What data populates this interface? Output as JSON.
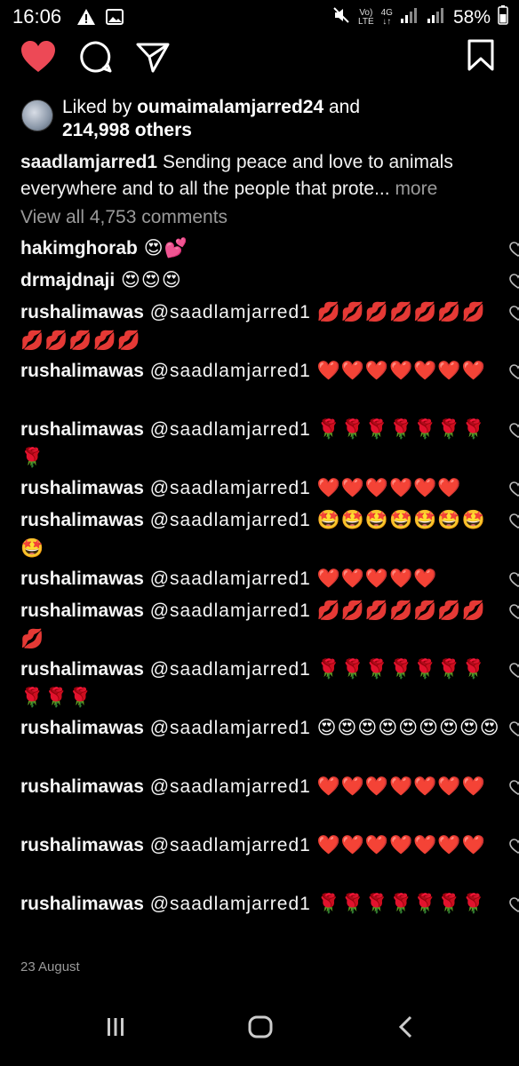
{
  "status_bar": {
    "time": "16:06",
    "net_top": "Vo)",
    "net_bottom": "LTE",
    "net2_top": "4G",
    "net2_bottom": "↓↑",
    "battery": "58%"
  },
  "post": {
    "likes_prefix": "Liked by ",
    "liked_by_user": "oumaimalamjarred24",
    "likes_and": " and",
    "likes_others": "214,998 others",
    "caption_user": "saadlamjarred1",
    "caption_text": " Sending peace and love to animals everywhere and to all the people that prote...",
    "more_label": " more",
    "view_all_comments": "View all 4,753 comments",
    "date": "23 August"
  },
  "comments": [
    {
      "user": "hakimghorab",
      "text": " 😍💕"
    },
    {
      "user": "drmajdnaji",
      "text": " 😍😍😍"
    },
    {
      "user": "rushalimawas",
      "text": " @saadlamjarred1 💋💋💋💋💋💋💋💋💋💋💋💋"
    },
    {
      "user": "rushalimawas",
      "text": " @saadlamjarred1 ❤️❤️❤️❤️❤️❤️❤️"
    },
    {
      "user": "rushalimawas",
      "text": " @saadlamjarred1 🌹🌹🌹🌹🌹🌹🌹🌹"
    },
    {
      "user": "rushalimawas",
      "text": " @saadlamjarred1 ❤️❤️❤️❤️❤️❤️"
    },
    {
      "user": "rushalimawas",
      "text": " @saadlamjarred1 🤩🤩🤩🤩🤩🤩🤩🤩"
    },
    {
      "user": "rushalimawas",
      "text": " @saadlamjarred1 ❤️❤️❤️❤️❤️"
    },
    {
      "user": "rushalimawas",
      "text": " @saadlamjarred1 💋💋💋💋💋💋💋💋"
    },
    {
      "user": "rushalimawas",
      "text": " @saadlamjarred1 🌹🌹🌹🌹🌹🌹🌹🌹🌹🌹"
    },
    {
      "user": "rushalimawas",
      "text": " @saadlamjarred1 😍😍😍😍😍😍😍😍😍"
    },
    {
      "user": "rushalimawas",
      "text": " @saadlamjarred1 ❤️❤️❤️❤️❤️❤️❤️"
    },
    {
      "user": "rushalimawas",
      "text": " @saadlamjarred1 ❤️❤️❤️❤️❤️❤️❤️"
    },
    {
      "user": "rushalimawas",
      "text": " @saadlamjarred1 🌹🌹🌹🌹🌹🌹🌹"
    }
  ],
  "colors": {
    "like_red": "#ed4956",
    "muted_text": "#9a9a9a",
    "background": "#000000"
  }
}
